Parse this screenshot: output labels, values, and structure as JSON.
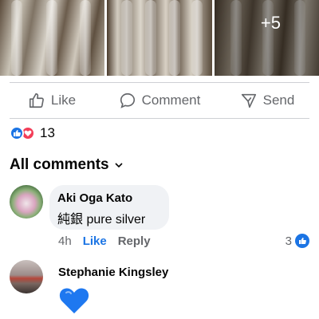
{
  "photos": {
    "more_count": "+5"
  },
  "actions": {
    "like": "Like",
    "comment": "Comment",
    "send": "Send"
  },
  "reactions": {
    "count": "13"
  },
  "comments_header": {
    "label": "All comments"
  },
  "comments": [
    {
      "author": "Aki Oga Kato",
      "text": "純銀 pure silver",
      "time": "4h",
      "like": "Like",
      "reply": "Reply",
      "reaction_count": "3"
    },
    {
      "author": "Stephanie Kingsley",
      "text": "💙"
    }
  ],
  "colors": {
    "accent": "#1b74e4",
    "love": "#f33e58",
    "secondary_text": "#65676b",
    "bubble": "#f0f2f5",
    "heart": "#1e78f0"
  }
}
